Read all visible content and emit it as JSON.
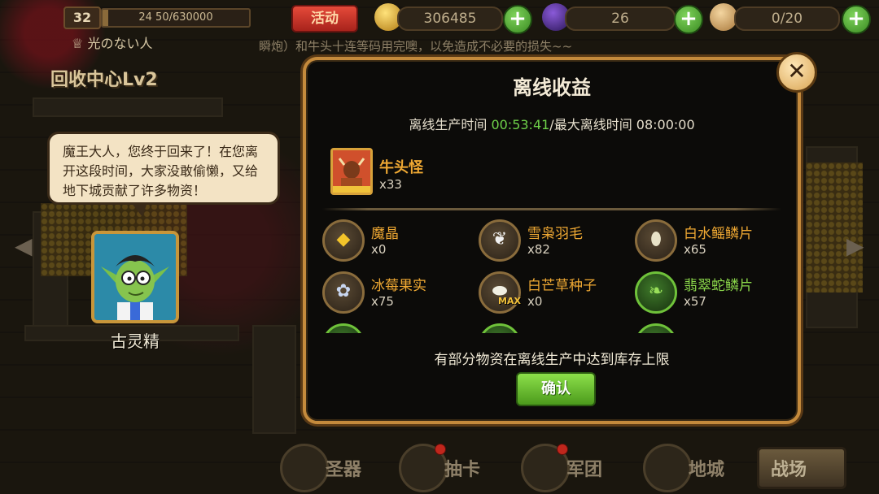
{
  "hud": {
    "level": "32",
    "exp_text": "24 50/630000",
    "exp_progress": 0.04,
    "event_label": "活动",
    "gold": "306485",
    "crystal": "26",
    "population": "0/20",
    "plus": "+",
    "player_name": "光のない人",
    "notice": "瞬炮）和牛头十连等码用完噢，以免造成不必要的损失~~",
    "room_title": "回收中心Lv2"
  },
  "npc": {
    "speech": "魔王大人，您终于回来了！在您离开这段时间，大家没敢偷懒，又给地下城贡献了许多物资！",
    "name": "古灵精"
  },
  "modal": {
    "title": "离线收益",
    "close": "✕",
    "time_prefix": "离线生产时间 ",
    "offline_time": "00:53:41",
    "time_middle": "/最大离线时间 ",
    "max_time": "08:00:00",
    "monster": {
      "name": "牛头怪",
      "count": "x33"
    },
    "items": [
      {
        "name": "魔晶",
        "count": "x0",
        "icon": "crystal-icon",
        "glyph": "◆"
      },
      {
        "name": "雪枭羽毛",
        "count": "x82",
        "icon": "feather-icon",
        "glyph": "❦"
      },
      {
        "name": "白水鳐鳞片",
        "count": "x65",
        "icon": "scale-icon",
        "glyph": "⬮"
      },
      {
        "name": "冰莓果实",
        "count": "x75",
        "icon": "berry-icon",
        "glyph": "✿"
      },
      {
        "name": "白芒草种子",
        "count": "x0",
        "icon": "seed-icon",
        "glyph": "⬬",
        "max": "MAX"
      },
      {
        "name": "翡翠蛇鳞片",
        "count": "x57",
        "icon": "leaf-icon",
        "glyph": "❧",
        "green": true
      }
    ],
    "limit_notice": "有部分物资在离线生产中达到库存上限",
    "confirm": "确认"
  },
  "nav": {
    "relic": "圣器",
    "draw": "抽卡",
    "legion": "军团",
    "territory": "地城",
    "battle": "战场"
  },
  "colors": {
    "accent_gold": "#f0a933",
    "time_green": "#6fd24a",
    "modal_border": "#c48a3c",
    "confirm_green": "#6cc033"
  }
}
